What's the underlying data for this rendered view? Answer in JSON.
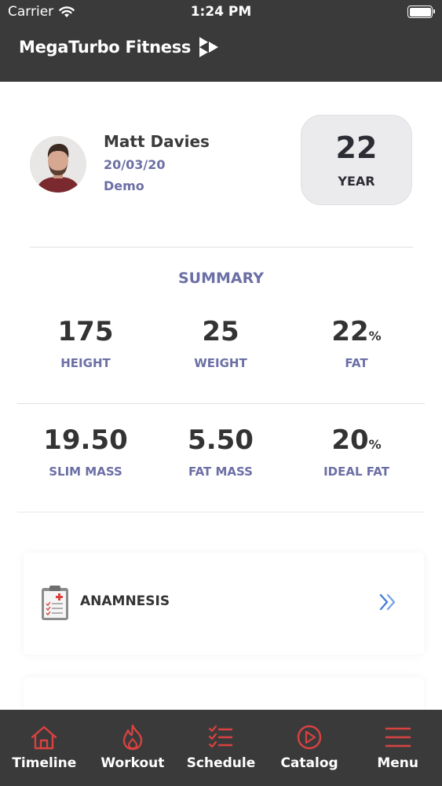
{
  "status_bar": {
    "carrier": "Carrier",
    "time": "1:24 PM"
  },
  "app": {
    "brand": "MegaTurbo Fitness"
  },
  "profile": {
    "name": "Matt Davies",
    "date": "20/03/20",
    "plan": "Demo",
    "age_value": "22",
    "age_label": "YEAR"
  },
  "summary": {
    "title": "SUMMARY",
    "metrics": [
      {
        "value": "175",
        "unit": "",
        "label": "HEIGHT"
      },
      {
        "value": "25",
        "unit": "",
        "label": "WEIGHT"
      },
      {
        "value": "22",
        "unit": "%",
        "label": "FAT"
      },
      {
        "value": "19.50",
        "unit": "",
        "label": "SLIM MASS"
      },
      {
        "value": "5.50",
        "unit": "",
        "label": "FAT MASS"
      },
      {
        "value": "20",
        "unit": "%",
        "label": "IDEAL FAT"
      }
    ]
  },
  "cards": [
    {
      "label": "ANAMNESIS",
      "icon": "clipboard-icon"
    }
  ],
  "tabs": [
    {
      "label": "Timeline",
      "icon": "home-icon"
    },
    {
      "label": "Workout",
      "icon": "flame-icon"
    },
    {
      "label": "Schedule",
      "icon": "checklist-icon"
    },
    {
      "label": "Catalog",
      "icon": "play-circle-icon"
    },
    {
      "label": "Menu",
      "icon": "hamburger-icon"
    }
  ],
  "colors": {
    "header_bg": "#3b3a3b",
    "accent": "#6c6fa5",
    "tab_icon": "#d9423f",
    "chevron": "#4a7fd6"
  }
}
